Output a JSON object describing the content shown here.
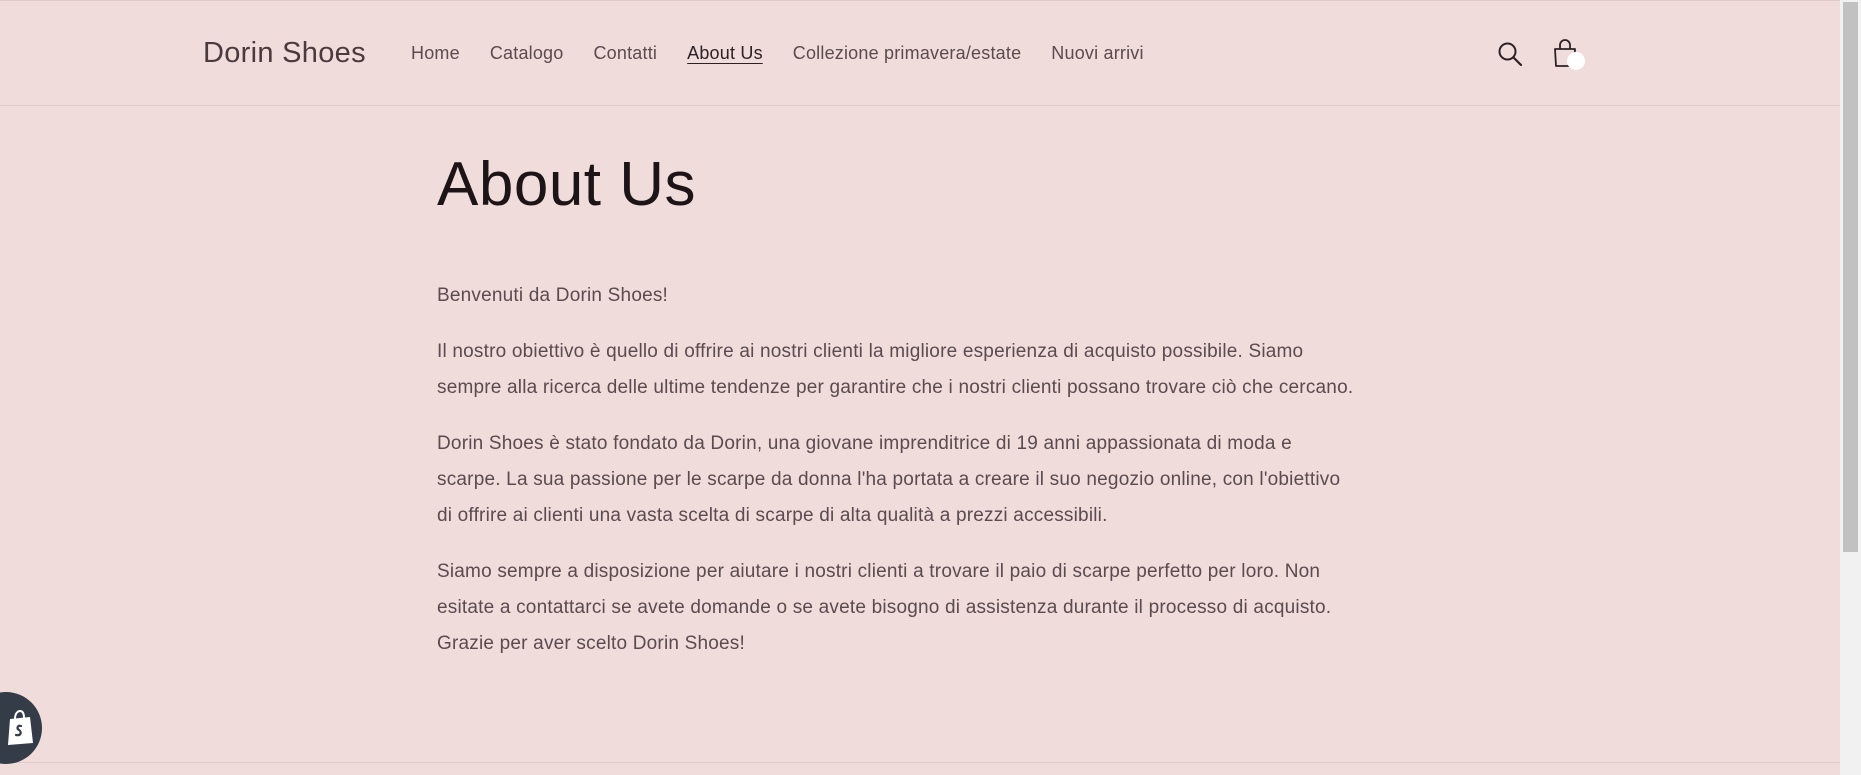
{
  "header": {
    "brand": "Dorin Shoes",
    "nav": [
      {
        "label": "Home",
        "active": false
      },
      {
        "label": "Catalogo",
        "active": false
      },
      {
        "label": "Contatti",
        "active": false
      },
      {
        "label": "About Us",
        "active": true
      },
      {
        "label": "Collezione primavera/estate",
        "active": false
      },
      {
        "label": "Nuovi arrivi",
        "active": false
      }
    ],
    "icons": {
      "search": "search-icon",
      "cart": "shopping-bag-icon"
    }
  },
  "main": {
    "title": "About Us",
    "paragraphs": [
      "Benvenuti da Dorin Shoes!",
      "Il nostro obiettivo è quello di offrire ai nostri clienti la migliore esperienza di acquisto possibile. Siamo sempre alla ricerca delle ultime tendenze per garantire che i nostri clienti possano trovare ciò che cercano.",
      "Dorin Shoes è stato fondato da Dorin, una giovane imprenditrice di 19 anni appassionata di moda e scarpe. La sua passione per le scarpe da donna l'ha portata a creare il suo negozio online, con l'obiettivo di offrire ai clienti una vasta scelta di scarpe di alta qualità a prezzi accessibili.",
      "Siamo sempre a disposizione per aiutare i nostri clienti a trovare il paio di scarpe perfetto per loro. Non esitate a contattarci se avete domande o se avete bisogno di assistenza durante il processo di acquisto. Grazie per aver scelto Dorin Shoes!"
    ]
  },
  "colors": {
    "background": "#f1dcdc",
    "text": "#5b4a4e",
    "heading": "#1c1416",
    "badge": "#333c47"
  }
}
